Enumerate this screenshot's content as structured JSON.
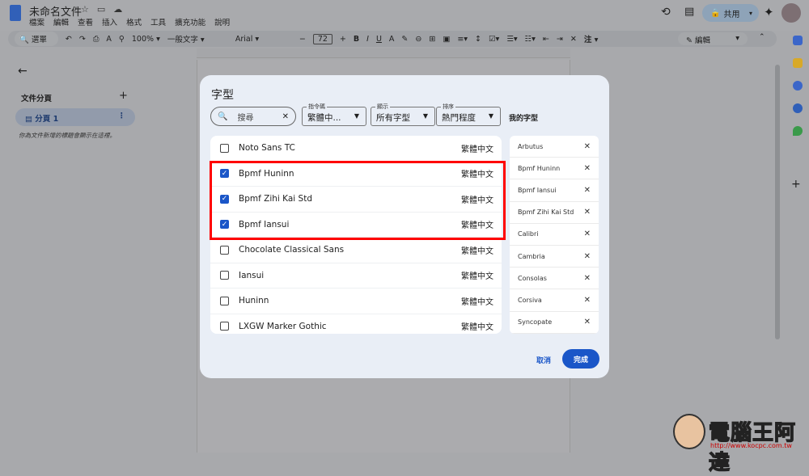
{
  "app": {
    "title": "未命名文件",
    "menu": [
      "檔案",
      "編輯",
      "查看",
      "插入",
      "格式",
      "工具",
      "擴充功能",
      "說明"
    ],
    "share": "共用",
    "edit_mode": "編輯"
  },
  "toolbar": {
    "search": "選單",
    "zoom": "100%",
    "style": "一般文字",
    "font": "Arial",
    "size": "72",
    "note": "注"
  },
  "left_panel": {
    "title": "文件分頁",
    "tab": "分頁 1",
    "hint": "你為文件新增的標題會顯示在這裡。"
  },
  "dialog": {
    "title": "字型",
    "search_placeholder": "搜尋",
    "filters": [
      {
        "label": "指令碼",
        "value": "繁體中..."
      },
      {
        "label": "顯示",
        "value": "所有字型"
      },
      {
        "label": "排序",
        "value": "熱門程度"
      }
    ],
    "my_fonts_label": "我的字型",
    "fonts": [
      {
        "name": "Noto Sans TC",
        "lang": "繁體中文",
        "checked": false
      },
      {
        "name": "Bpmf Huninn",
        "lang": "繁體中文",
        "checked": true
      },
      {
        "name": "Bpmf Zihi Kai Std",
        "lang": "繁體中文",
        "checked": true
      },
      {
        "name": "Bpmf Iansui",
        "lang": "繁體中文",
        "checked": true
      },
      {
        "name": "Chocolate Classical Sans",
        "lang": "繁體中文",
        "checked": false
      },
      {
        "name": "Iansui",
        "lang": "繁體中文",
        "checked": false
      },
      {
        "name": "Huninn",
        "lang": "繁體中文",
        "checked": false
      },
      {
        "name": "LXGW Marker Gothic",
        "lang": "繁體中文",
        "checked": false
      }
    ],
    "my_fonts": [
      "Arbutus",
      "Bpmf Huninn",
      "Bpmf Iansui",
      "Bpmf Zihi Kai Std",
      "Calibri",
      "Cambria",
      "Consolas",
      "Corsiva",
      "Syncopate"
    ],
    "cancel": "取消",
    "done": "完成"
  },
  "watermark": {
    "text": "電腦王阿達",
    "url": "http://www.kocpc.com.tw"
  },
  "colors": {
    "accent": "#1a56c8",
    "highlight": "#ff0000"
  }
}
